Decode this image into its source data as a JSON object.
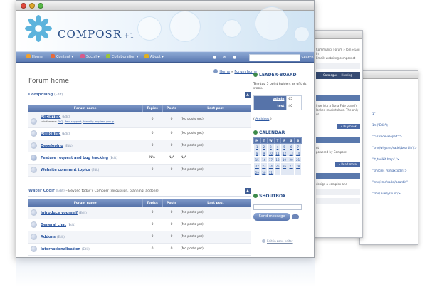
{
  "brand": {
    "name": "COMPOSR",
    "suffix": "+1"
  },
  "nav": {
    "items": [
      {
        "label": "Home",
        "icon": "home-icon",
        "color": "#f0a030"
      },
      {
        "label": "Content ▾",
        "icon": "content-icon",
        "color": "#e86a3a"
      },
      {
        "label": "Social ▾",
        "icon": "social-icon",
        "color": "#d85a8a"
      },
      {
        "label": "Collaboration ▾",
        "icon": "collaboration-icon",
        "color": "#9bc43a"
      },
      {
        "label": "About ▾",
        "icon": "about-icon",
        "color": "#e0b020"
      }
    ],
    "search_placeholder": "",
    "search_button": "Search"
  },
  "breadcrumb": {
    "home": "Home",
    "sep": "»",
    "current": "Forum home"
  },
  "page_title": "Forum home",
  "table_headers": [
    "Forum name",
    "Topics",
    "Posts",
    "Last post"
  ],
  "categories": [
    {
      "name": "Composing",
      "edit": "(Edit)",
      "description": "",
      "forums": [
        {
          "name": "Deploying",
          "edit": "(Edit)",
          "sub_label": "sub-forums:",
          "subs": [
            "FAQ",
            "Paid support",
            "Visually-inspired group"
          ],
          "topics": "0",
          "posts": "0",
          "last": "(No posts yet)"
        },
        {
          "name": "Designing",
          "edit": "(Edit)",
          "topics": "0",
          "posts": "0",
          "last": "(No posts yet)"
        },
        {
          "name": "Developing",
          "edit": "(Edit)",
          "topics": "0",
          "posts": "0",
          "last": "(No posts yet)"
        },
        {
          "name": "Feature request and bug tracking",
          "edit": "(Edit)",
          "topics": "N/A",
          "posts": "N/A",
          "last": "N/A"
        },
        {
          "name": "Website comment topics",
          "edit": "(Edit)",
          "topics": "0",
          "posts": "0",
          "last": "(No posts yet)"
        }
      ]
    },
    {
      "name": "Water Coolr",
      "edit": "(Edit)",
      "description": "– Beyond today’s Composr (discussion, planning, addons)",
      "forums": [
        {
          "name": "Introduce yourself",
          "edit": "(Edit)",
          "topics": "0",
          "posts": "0",
          "last": "(No posts yet)"
        },
        {
          "name": "General chat",
          "edit": "(Edit)",
          "topics": "0",
          "posts": "0",
          "last": "(No posts yet)"
        },
        {
          "name": "Addons",
          "edit": "(Edit)",
          "topics": "0",
          "posts": "0",
          "last": "(No posts yet)"
        },
        {
          "name": "Internationalisation",
          "edit": "(Edit)",
          "topics": "0",
          "posts": "0",
          "last": "(No posts yet)"
        }
      ]
    }
  ],
  "sidebar": {
    "leaderboard": {
      "title": "LEADER-BOARD",
      "text": "The top 5 point holders as of this week.",
      "rows": [
        {
          "name": "admin",
          "value": "65"
        },
        {
          "name": "test",
          "value": "40"
        }
      ],
      "archives_open": "(",
      "archives": "Archives",
      "archives_close": ")"
    },
    "calendar": {
      "title": "CALENDAR",
      "days": [
        "M",
        "T",
        "W",
        "T",
        "F",
        "S",
        "S"
      ],
      "weeks": [
        [
          "1",
          "2",
          "3",
          "4",
          "5",
          "6",
          "7"
        ],
        [
          "8",
          "9",
          "10",
          "11",
          "12",
          "13",
          "14"
        ],
        [
          "15",
          "16",
          "17",
          "18",
          "19",
          "20",
          "21"
        ],
        [
          "22",
          "23",
          "24",
          "25",
          "26",
          "27",
          "28"
        ],
        [
          "29",
          "30",
          "31",
          "",
          "",
          "",
          ""
        ]
      ]
    },
    "shoutbox": {
      "title": "SHOUTBOX",
      "button": "Send message"
    },
    "edit_zone": "Edit in zone editor"
  },
  "bg_windows": {
    "window2": {
      "lines": [
        "Community Forum » Join » Log In",
        "Email: website@composr.ct",
        "Subscriptions"
      ],
      "tabs": [
        "Catalogue",
        "Hosting"
      ],
      "texts": [
        "ince into a Bona Fide brand's",
        "lonked marketplace. The only",
        "ss.",
        "nt",
        "powered by Composr.",
        "design a complex and"
      ],
      "buttons": [
        "» Buy book",
        "» Read more"
      ]
    },
    "window3": {
      "lines": [
        "1\"]",
        "1m(\"Edit\");",
        "\"cas.sedeveloped\"/>",
        "\"sms/whysms/sadel/boardin\"/>",
        "\"tt_toolkit.bmp\" />",
        "\"sm/cms_/s.maxcodin\">",
        "\"cms/cms/sadel/boardin\"",
        "\"sms/.Filesyspuo\"/>"
      ]
    }
  },
  "colors": {
    "nav_top": "#8eaad5",
    "nav_bottom": "#5977b0",
    "header_blue": "#5673a9",
    "link": "#2b56a0",
    "sidebar_bullet": "#3c8a4a"
  }
}
